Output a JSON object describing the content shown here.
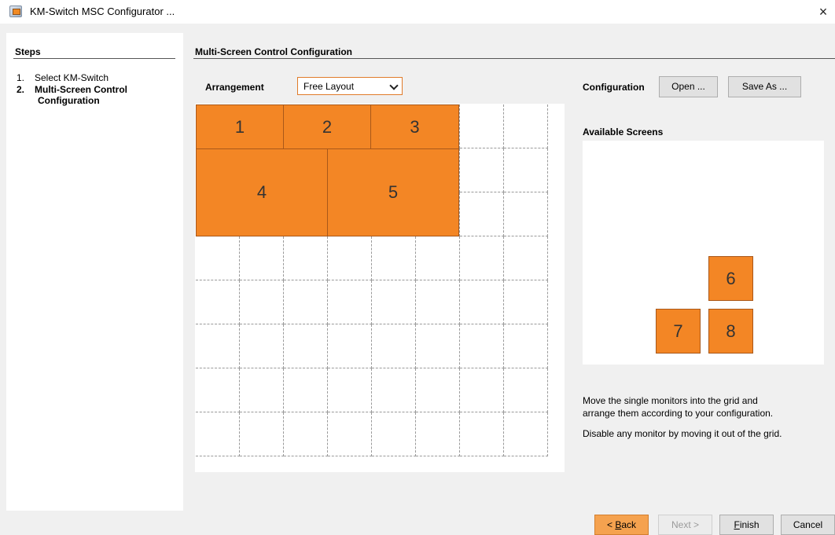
{
  "window": {
    "title": "KM-Switch MSC Configurator ...",
    "close_glyph": "×"
  },
  "steps": {
    "header": "Steps",
    "items": [
      {
        "num": "1.",
        "label": "Select KM-Switch",
        "active": false
      },
      {
        "num": "2.",
        "label_line1": "Multi-Screen Control",
        "label_line2": "Configuration",
        "active": true
      }
    ]
  },
  "main": {
    "header": "Multi-Screen Control Configuration",
    "arrangement_label": "Arrangement",
    "arrangement_value": "Free Layout",
    "configuration_label": "Configuration",
    "open_button": "Open ...",
    "save_as_button": "Save As ...",
    "available_screens_label": "Available Screens",
    "grid_screens": [
      "1",
      "2",
      "3",
      "4",
      "5"
    ],
    "available_screens": [
      "6",
      "7",
      "8"
    ],
    "help_line1": "Move the single monitors into the grid and",
    "help_line2": "arrange them according to your configuration.",
    "help_line3": "Disable any monitor by moving it out of the grid."
  },
  "footer": {
    "back_prefix": "< ",
    "back_mnemonic": "B",
    "back_rest": "ack",
    "next": "Next >",
    "finish_mnemonic": "F",
    "finish_rest": "inish",
    "cancel": "Cancel"
  },
  "colors": {
    "accent": "#f38625",
    "screen_border": "#a9581a"
  }
}
